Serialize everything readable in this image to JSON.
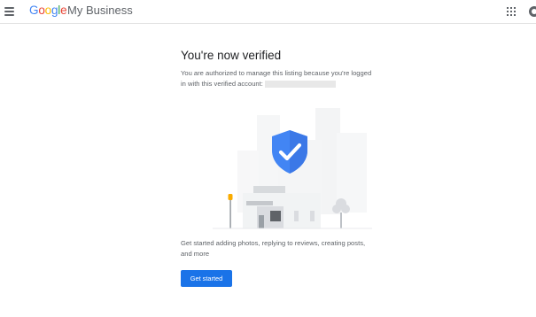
{
  "header": {
    "logo_letters": [
      "G",
      "o",
      "o",
      "g",
      "l",
      "e"
    ],
    "product_name": "My Business",
    "menu_icon": "hamburger-menu-icon",
    "apps_icon": "apps-grid-icon",
    "account_icon": "account-avatar-icon"
  },
  "main": {
    "title": "You're now verified",
    "description": "You are authorized to manage this listing because you're logged in with this verified account:",
    "illustration_icon": "verified-shield-check-icon",
    "subtext": "Get started adding photos, replying to reviews, creating posts, and more",
    "cta_label": "Get started"
  },
  "colors": {
    "accent": "#1a73e8",
    "shield": "#4285f4"
  }
}
